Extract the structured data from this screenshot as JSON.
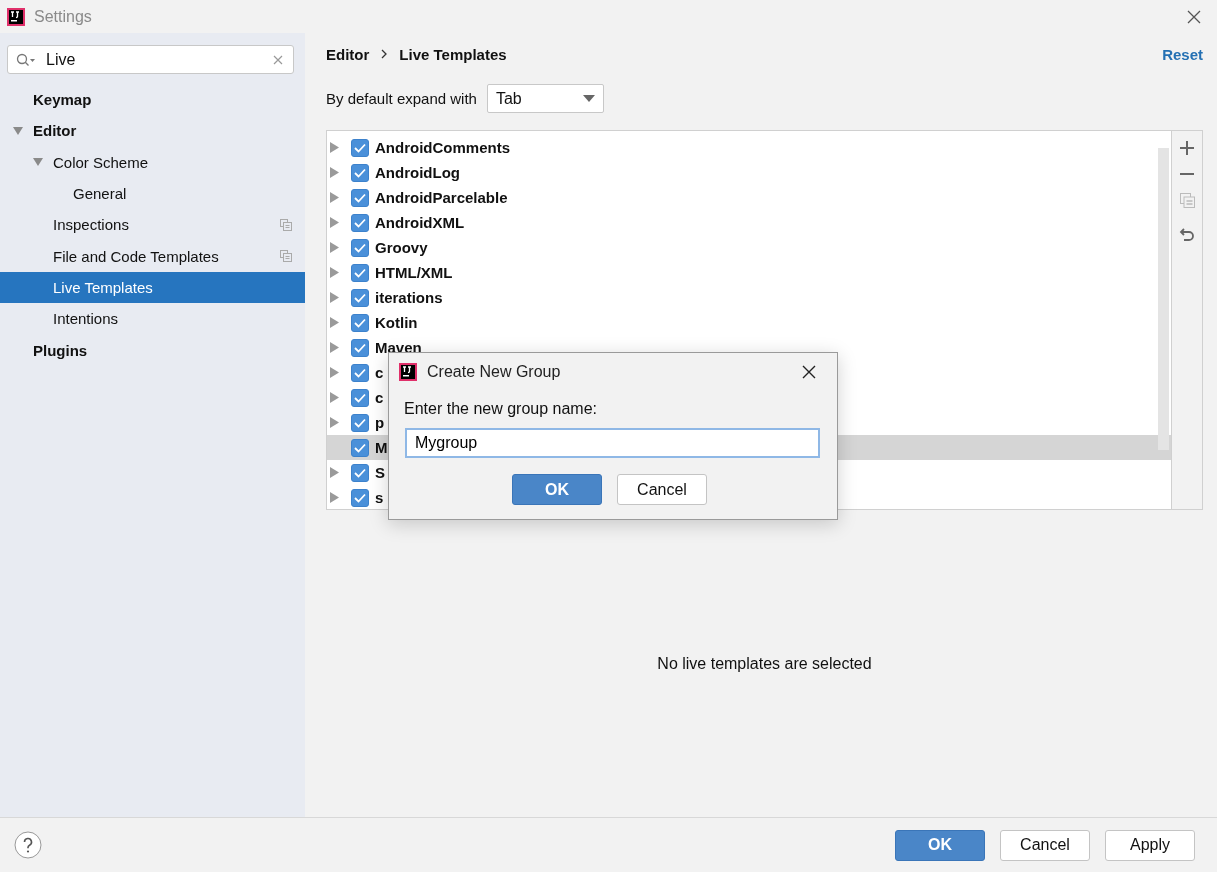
{
  "window": {
    "title": "Settings"
  },
  "search": {
    "value": "Live"
  },
  "sidebar": {
    "items": [
      {
        "label": "Keymap",
        "selected": false,
        "scoped": false
      },
      {
        "label": "Editor",
        "selected": false,
        "expanded": true,
        "scoped": false,
        "children": [
          {
            "label": "Color Scheme",
            "selected": false,
            "expanded": true,
            "scoped": false,
            "children": [
              {
                "label": "General",
                "selected": false,
                "scoped": false
              }
            ]
          },
          {
            "label": "Inspections",
            "selected": false,
            "scoped": true
          },
          {
            "label": "File and Code Templates",
            "selected": false,
            "scoped": true
          },
          {
            "label": "Live Templates",
            "selected": true,
            "scoped": false
          },
          {
            "label": "Intentions",
            "selected": false,
            "scoped": false
          }
        ]
      },
      {
        "label": "Plugins",
        "selected": false,
        "scoped": false
      }
    ]
  },
  "breadcrumb": [
    "Editor",
    "Live Templates"
  ],
  "reset_link": "Reset",
  "expand_with": {
    "label": "By default expand with",
    "value": "Tab"
  },
  "template_groups": [
    {
      "label": "AndroidComments",
      "checked": true,
      "selected": false,
      "expandable": true
    },
    {
      "label": "AndroidLog",
      "checked": true,
      "selected": false,
      "expandable": true
    },
    {
      "label": "AndroidParcelable",
      "checked": true,
      "selected": false,
      "expandable": true
    },
    {
      "label": "AndroidXML",
      "checked": true,
      "selected": false,
      "expandable": true
    },
    {
      "label": "Groovy",
      "checked": true,
      "selected": false,
      "expandable": true
    },
    {
      "label": "HTML/XML",
      "checked": true,
      "selected": false,
      "expandable": true
    },
    {
      "label": "iterations",
      "checked": true,
      "selected": false,
      "expandable": true
    },
    {
      "label": "Kotlin",
      "checked": true,
      "selected": false,
      "expandable": true
    },
    {
      "label": "Maven",
      "checked": true,
      "selected": false,
      "expandable": true
    },
    {
      "label": "c",
      "checked": true,
      "selected": false,
      "expandable": true
    },
    {
      "label": "c",
      "checked": true,
      "selected": false,
      "expandable": true
    },
    {
      "label": "p",
      "checked": true,
      "selected": false,
      "expandable": true
    },
    {
      "label": "M",
      "checked": true,
      "selected": true,
      "expandable": false
    },
    {
      "label": "S",
      "checked": true,
      "selected": false,
      "expandable": true
    },
    {
      "label": "s",
      "checked": true,
      "selected": false,
      "expandable": true
    }
  ],
  "empty_message": "No live templates are selected",
  "dialog": {
    "title": "Create New Group",
    "prompt": "Enter the new group name:",
    "value": "Mygroup",
    "ok": "OK",
    "cancel": "Cancel"
  },
  "buttons": [
    {
      "label": "OK",
      "kind": "primary"
    },
    {
      "label": "Cancel",
      "kind": "normal"
    },
    {
      "label": "Apply",
      "kind": "normal"
    }
  ]
}
